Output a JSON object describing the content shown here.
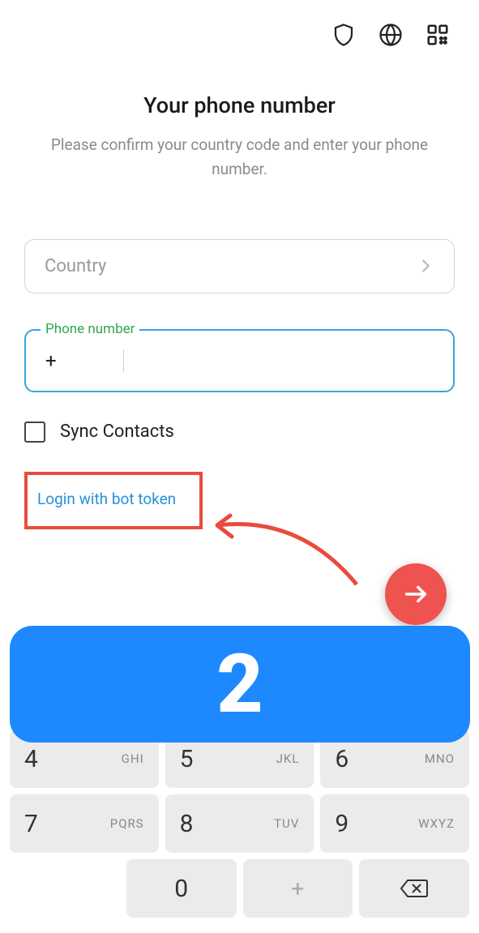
{
  "header": {
    "icons": [
      "shield-icon",
      "globe-icon",
      "qr-icon"
    ]
  },
  "title": "Your phone number",
  "subtitle": "Please confirm your country code and enter your phone number.",
  "country": {
    "placeholder": "Country"
  },
  "phone": {
    "label": "Phone number",
    "prefix": "+",
    "value": ""
  },
  "sync": {
    "label": "Sync Contacts",
    "checked": false
  },
  "bot_link": {
    "label": "Login with bot token"
  },
  "banner": {
    "number": "2"
  },
  "keypad": {
    "rows": [
      [
        {
          "digit": "4",
          "letters": "GHI"
        },
        {
          "digit": "5",
          "letters": "JKL"
        },
        {
          "digit": "6",
          "letters": "MNO"
        }
      ],
      [
        {
          "digit": "7",
          "letters": "PQRS"
        },
        {
          "digit": "8",
          "letters": "TUV"
        },
        {
          "digit": "9",
          "letters": "WXYZ"
        }
      ],
      [
        {
          "digit": "",
          "letters": ""
        },
        {
          "digit": "0",
          "letters": ""
        },
        {
          "digit": "+",
          "letters": ""
        },
        {
          "digit": "⌫",
          "letters": ""
        }
      ]
    ]
  }
}
